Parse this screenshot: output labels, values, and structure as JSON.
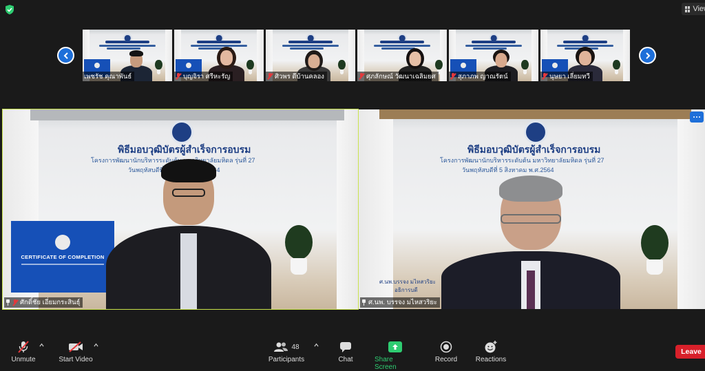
{
  "app": {
    "view_label": "View"
  },
  "gallery": {
    "tiles": [
      {
        "name": "เพชรัช คุณาพันธ์",
        "muted": false
      },
      {
        "name": "บุญจิรา ศรีหะรัญ",
        "muted": true
      },
      {
        "name": "ศิวพร ดีบ้านคลอง",
        "muted": true
      },
      {
        "name": "ศุภลักษณ์ วัฒนาเฉลิมยศ",
        "muted": true
      },
      {
        "name": "สุภาภพ ญาณรัตน์",
        "muted": true
      },
      {
        "name": "นุษยา เลี่ยมทวี",
        "muted": true
      }
    ]
  },
  "main": {
    "left": {
      "name": "ศักดิ์ชัย เอี่ยมกระสินธุ์",
      "pinned": true
    },
    "right": {
      "name": "ศ.นพ. บรรจง มไหสวริยะ",
      "pinned": true
    }
  },
  "banner": {
    "title": "พิธีมอบวุฒิบัตรผู้สำเร็จการอบรม",
    "subtitle": "โครงการพัฒนานักบริหารระดับต้น มหาวิทยาลัยมหิดล รุ่นที่ 27",
    "date": "วันพฤหัสบดีที่ 5 สิงหาคม พ.ศ.2564",
    "cert_title": "CERTIFICATE OF COMPLETION",
    "presenter_name": "ศ.นพ.บรรจง มไหสวริยะ",
    "presenter_role": "อธิการบดี"
  },
  "toolbar": {
    "unmute": "Unmute",
    "start_video": "Start Video",
    "participants": "Participants",
    "participants_count": "48",
    "chat": "Chat",
    "share_screen": "Share Screen",
    "record": "Record",
    "reactions": "Reactions",
    "leave": "Leave"
  },
  "colors": {
    "accent": "#1e6fd9",
    "active_speaker": "#c9e34c",
    "leave": "#d8202a",
    "share": "#2ecc71",
    "muted": "#e5383b"
  }
}
